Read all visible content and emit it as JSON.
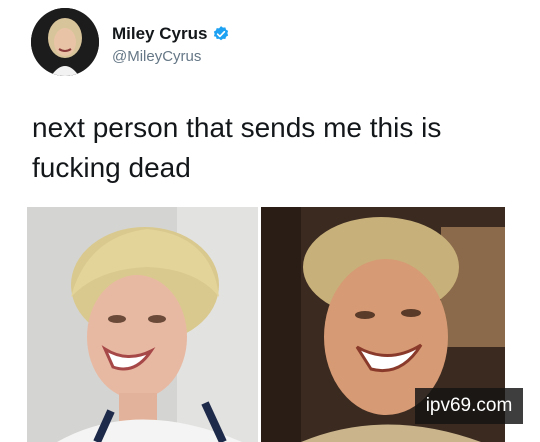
{
  "tweet": {
    "display_name": "Miley Cyrus",
    "handle": "@MileyCyrus",
    "text": "next person that sends me this is fucking dead",
    "verified": true
  },
  "icons": {
    "verified": "verified-badge-icon",
    "avatar": "profile-photo"
  },
  "watermark": {
    "text": "ipv69.com"
  },
  "colors": {
    "verified_badge": "#1da1f2",
    "handle": "#657786",
    "text": "#14171a",
    "watermark_bg": "#141414"
  }
}
